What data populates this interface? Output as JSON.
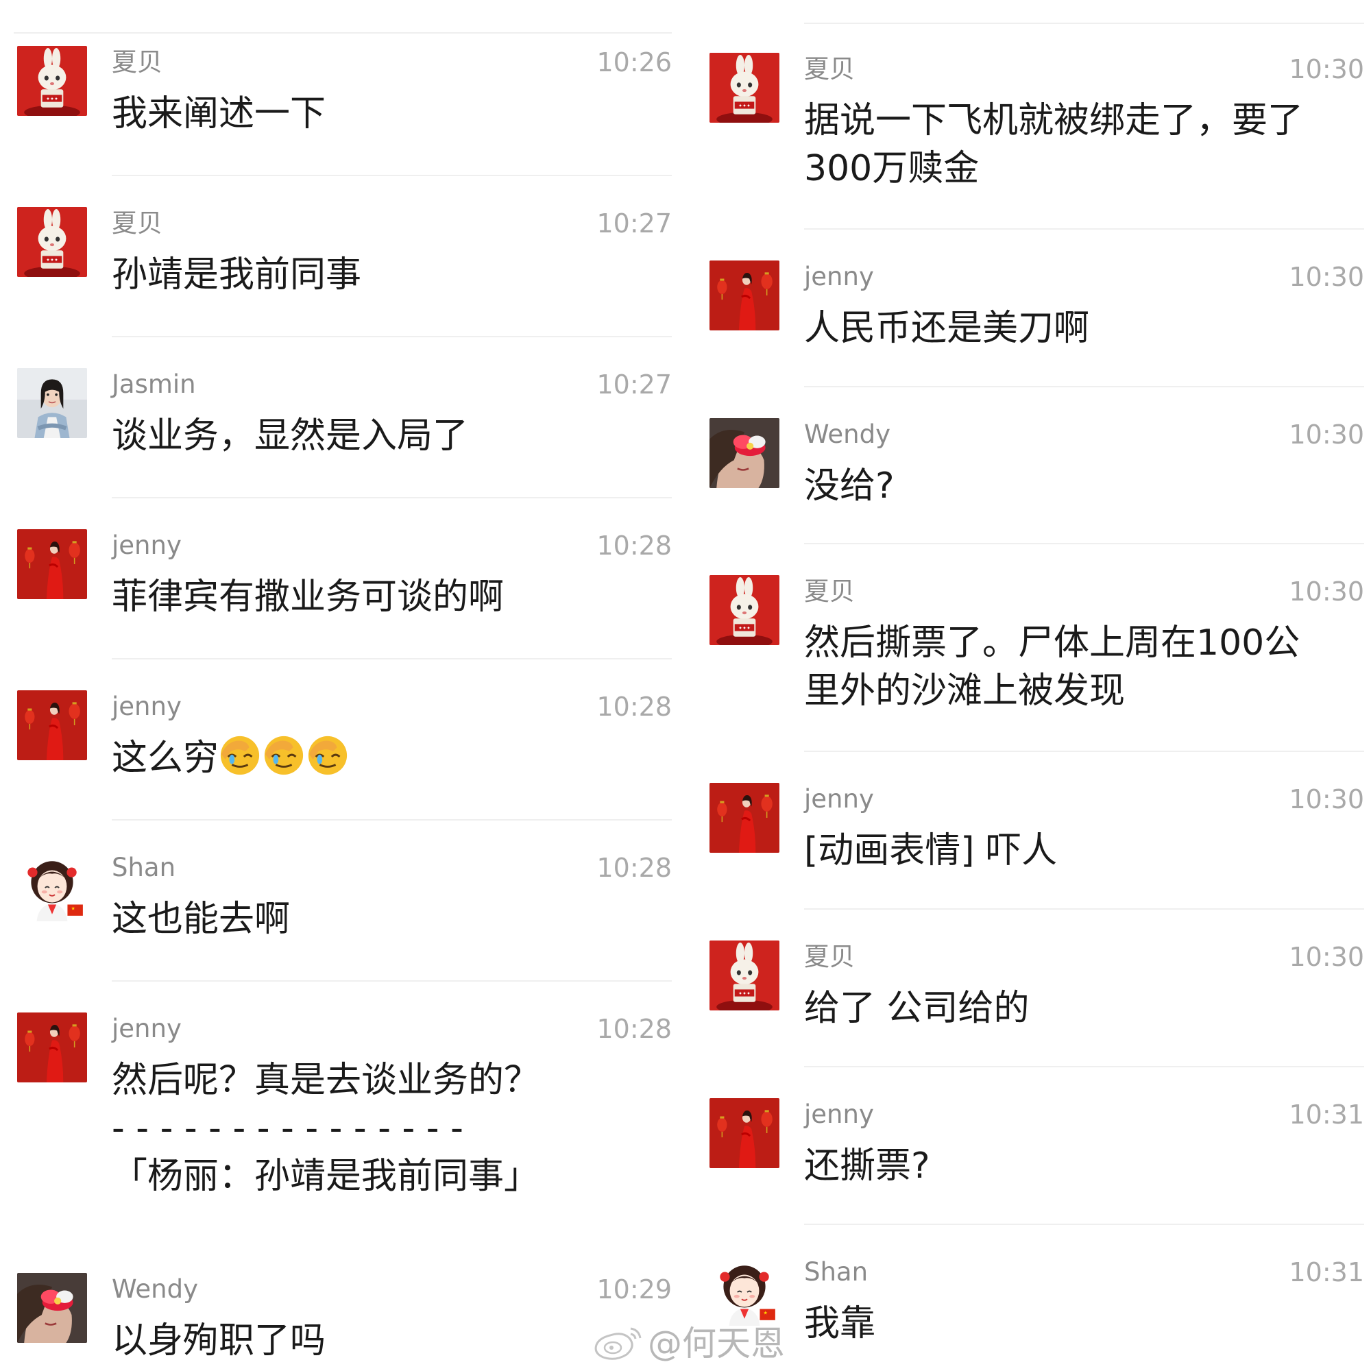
{
  "left_messages": [
    {
      "name": "夏贝",
      "time": "10:26",
      "text": "我来阐述一下",
      "avatar": "red-bunny-avatar"
    },
    {
      "name": "夏贝",
      "time": "10:27",
      "text": "孙靖是我前同事",
      "avatar": "red-bunny-avatar"
    },
    {
      "name": "Jasmin",
      "time": "10:27",
      "text": "谈业务，显然是入局了",
      "avatar": "woman-portrait-avatar"
    },
    {
      "name": "jenny",
      "time": "10:28",
      "text": "菲律宾有撒业务可谈的啊",
      "avatar": "red-lantern-avatar"
    },
    {
      "name": "jenny",
      "time": "10:28",
      "text": "这么穷",
      "emoji": "facepalm-emoji",
      "emoji_count": 3,
      "avatar": "red-lantern-avatar"
    },
    {
      "name": "Shan",
      "time": "10:28",
      "text": "这也能去啊",
      "avatar": "cartoon-girl-avatar"
    },
    {
      "name": "jenny",
      "time": "10:28",
      "text": "然后呢？真是去谈业务的？\n- - - - - - - - - - - - - - -\n「杨丽：孙靖是我前同事」",
      "avatar": "red-lantern-avatar"
    },
    {
      "name": "Wendy",
      "time": "10:29",
      "text": "以身殉职了吗",
      "avatar": "flower-face-avatar"
    }
  ],
  "right_messages": [
    {
      "name": "夏贝",
      "time": "10:30",
      "text": "据说一下飞机就被绑走了，要了\n300万赎金",
      "avatar": "red-bunny-avatar"
    },
    {
      "name": "jenny",
      "time": "10:30",
      "text": "人民币还是美刀啊",
      "avatar": "red-lantern-avatar"
    },
    {
      "name": "Wendy",
      "time": "10:30",
      "text": "没给?",
      "avatar": "flower-face-avatar"
    },
    {
      "name": "夏贝",
      "time": "10:30",
      "text": "然后撕票了。尸体上周在100公\n里外的沙滩上被发现",
      "avatar": "red-bunny-avatar"
    },
    {
      "name": "jenny",
      "time": "10:30",
      "text": "[动画表情] 吓人",
      "avatar": "red-lantern-avatar"
    },
    {
      "name": "夏贝",
      "time": "10:30",
      "text": "给了 公司给的",
      "avatar": "red-bunny-avatar"
    },
    {
      "name": "jenny",
      "time": "10:31",
      "text": "还撕票?",
      "avatar": "red-lantern-avatar"
    },
    {
      "name": "Shan",
      "time": "10:31",
      "text": "我靠",
      "avatar": "cartoon-girl-avatar"
    }
  ],
  "watermark": "@何天恩",
  "watermark_icon": "weibo-icon"
}
